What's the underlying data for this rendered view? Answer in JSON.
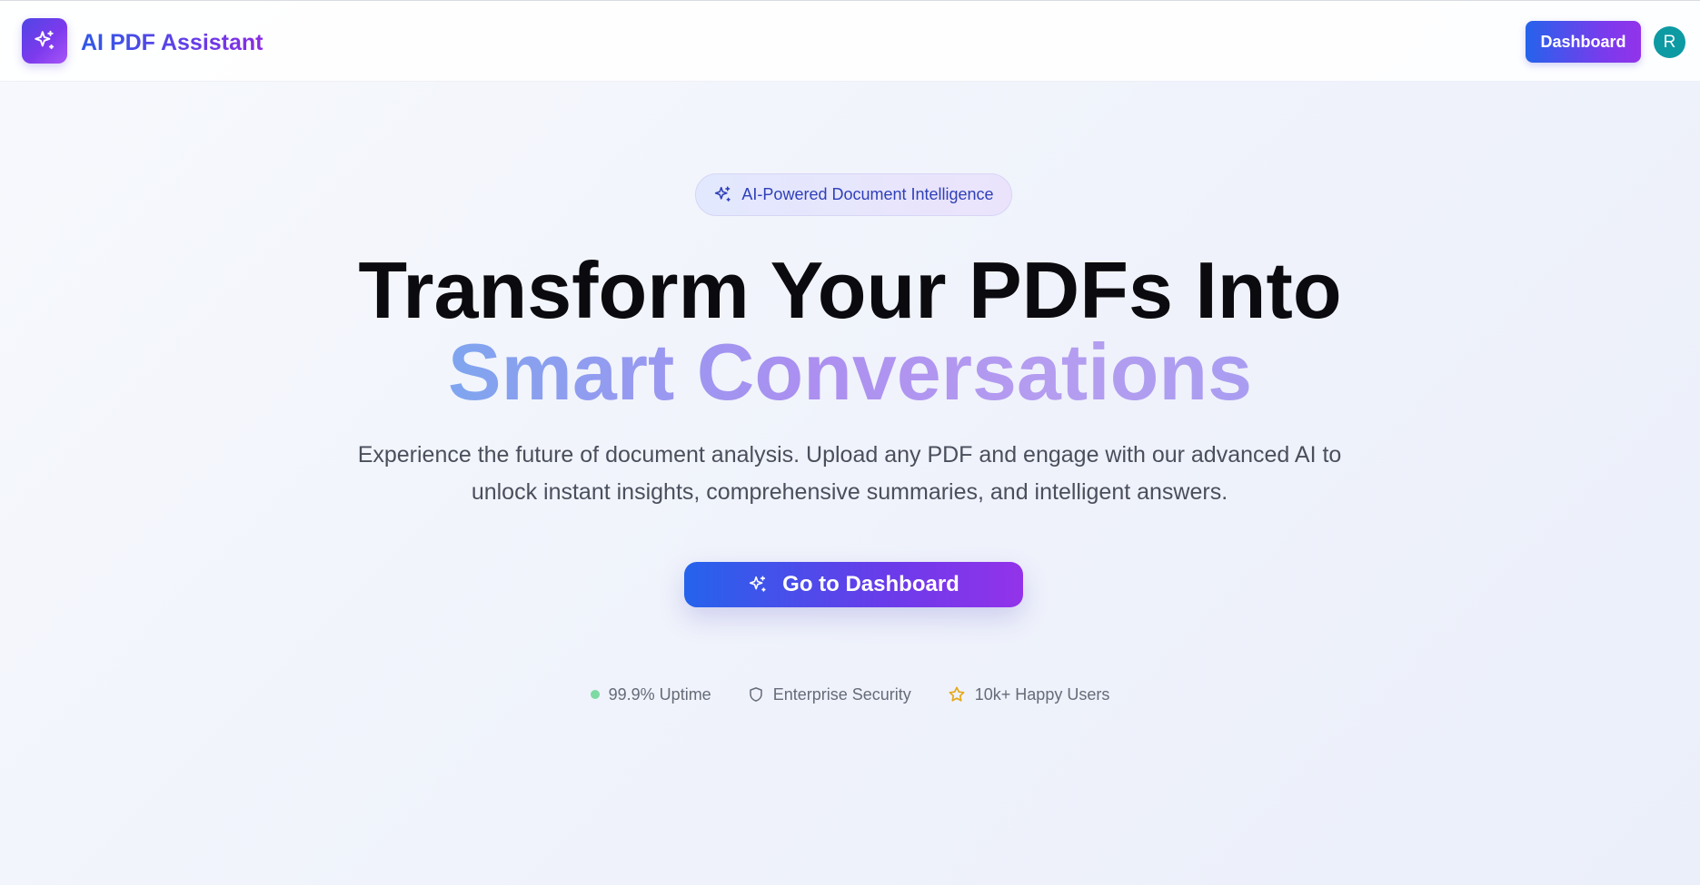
{
  "header": {
    "app_title": "AI PDF Assistant",
    "dashboard_label": "Dashboard",
    "avatar_initial": "R"
  },
  "hero": {
    "badge_label": "AI-Powered Document Intelligence",
    "headline_line1": "Transform Your PDFs Into",
    "headline_line2": "Smart Conversations",
    "subtitle": "Experience the future of document analysis. Upload any PDF and engage with our advanced AI to unlock instant insights, comprehensive summaries, and intelligent answers.",
    "cta_label": "Go to Dashboard"
  },
  "stats": [
    {
      "icon": "status-dot-icon",
      "label": "99.9% Uptime",
      "color": "#7fd9a3"
    },
    {
      "icon": "shield-icon",
      "label": "Enterprise Security",
      "color": "#656b78"
    },
    {
      "icon": "star-icon",
      "label": "10k+ Happy Users",
      "color": "#e6a817"
    }
  ],
  "colors": {
    "brand_start": "#2563eb",
    "brand_end": "#9333ea",
    "avatar_bg": "#0d9aa3"
  }
}
